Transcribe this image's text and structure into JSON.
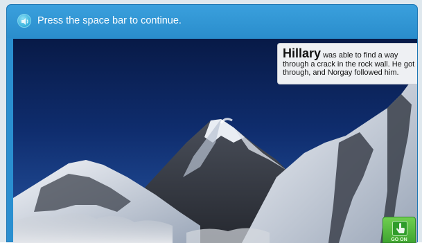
{
  "header": {
    "instruction": "Press the space bar to continue.",
    "audio_icon": "speaker-icon"
  },
  "caption": {
    "lead_word": "Hillary",
    "text": " was able to find a way through a crack in the rock wall. He got through, and Norgay followed him."
  },
  "scene": {
    "image": "snow-covered-mountain-peaks-photo"
  },
  "go_on_button": {
    "label": "GO ON",
    "icon": "hand-pointer-icon"
  },
  "colors": {
    "header_blue": "#2a8fd0",
    "button_green": "#4fb43c"
  }
}
